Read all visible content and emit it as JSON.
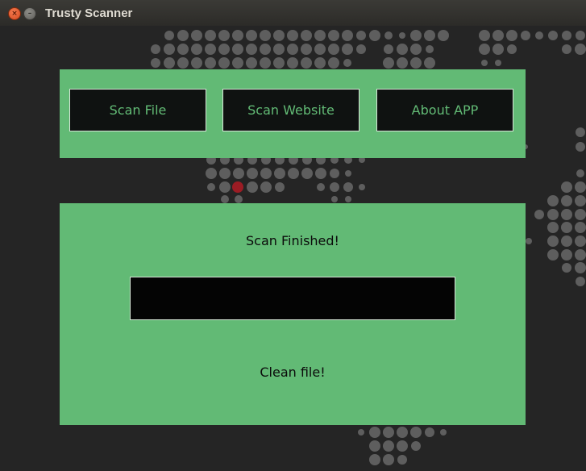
{
  "window": {
    "title": "Trusty Scanner",
    "close_icon": "close-icon",
    "minimize_icon": "minimize-icon"
  },
  "nav": {
    "scan_file": "Scan File",
    "scan_website": "Scan Website",
    "about": "About APP"
  },
  "result": {
    "status": "Scan Finished!",
    "output": "",
    "verdict": "Clean file!"
  },
  "colors": {
    "panel_green": "#62ba75",
    "button_bg": "#0f1211",
    "background": "#252525"
  }
}
